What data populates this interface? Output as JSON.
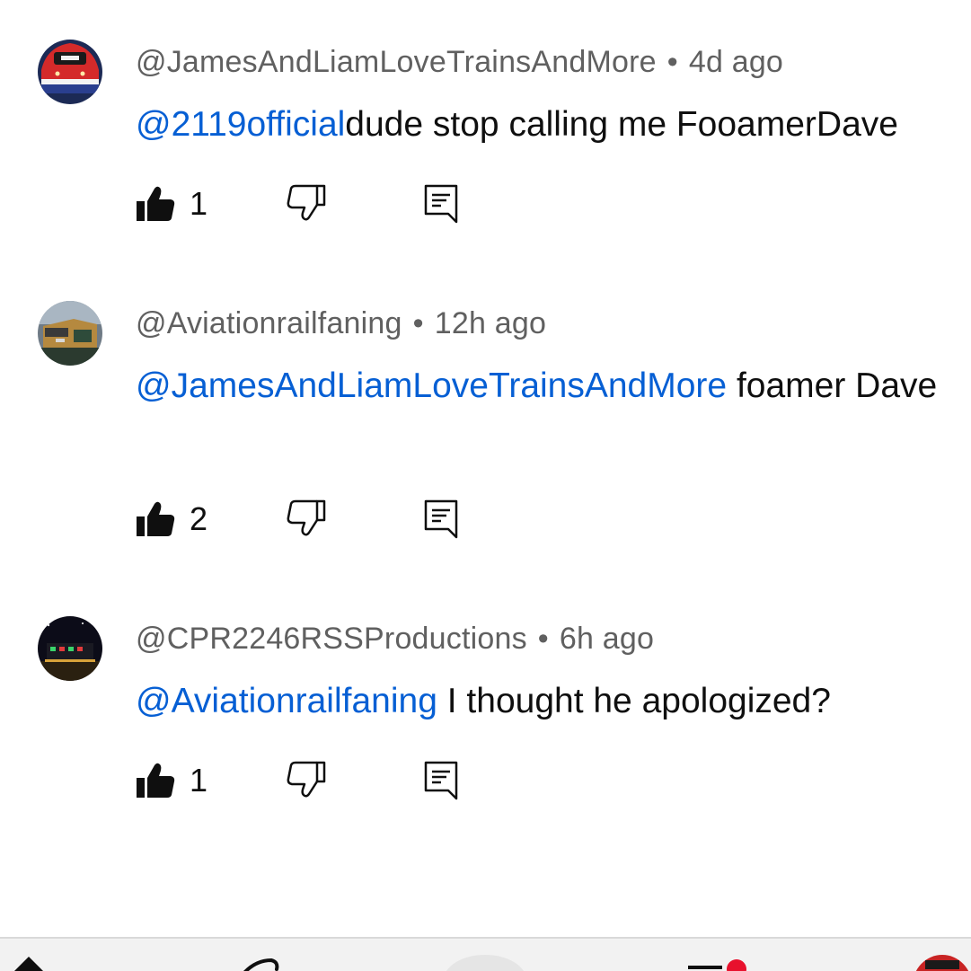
{
  "comments": [
    {
      "author": "@JamesAndLiamLoveTrainsAndMore",
      "separator": "•",
      "time": "4d ago",
      "mention": "@2119official",
      "text": "dude stop calling me FooamerDave",
      "likes": "1",
      "avatar_icon": "red-locomotive-avatar"
    },
    {
      "author": "@Aviationrailfaning",
      "separator": "•",
      "time": "12h ago",
      "mention": "@JamesAndLiamLoveTrainsAndMore",
      "text": " foamer Dave",
      "likes": "2",
      "avatar_icon": "freight-locomotive-avatar"
    },
    {
      "author": "@CPR2246RSSProductions",
      "separator": "•",
      "time": "6h ago",
      "mention": "@Aviationrailfaning",
      "text": " I thought he apologized?",
      "likes": "1",
      "avatar_icon": "night-train-avatar"
    }
  ],
  "colors": {
    "mention": "#065fd4",
    "meta": "#606060",
    "text": "#0f0f0f",
    "nav_background": "#f2f2f2"
  },
  "bottom_nav": {
    "items": [
      "home-icon",
      "shorts-icon",
      "create-icon",
      "subscriptions-icon",
      "profile-avatar"
    ]
  }
}
